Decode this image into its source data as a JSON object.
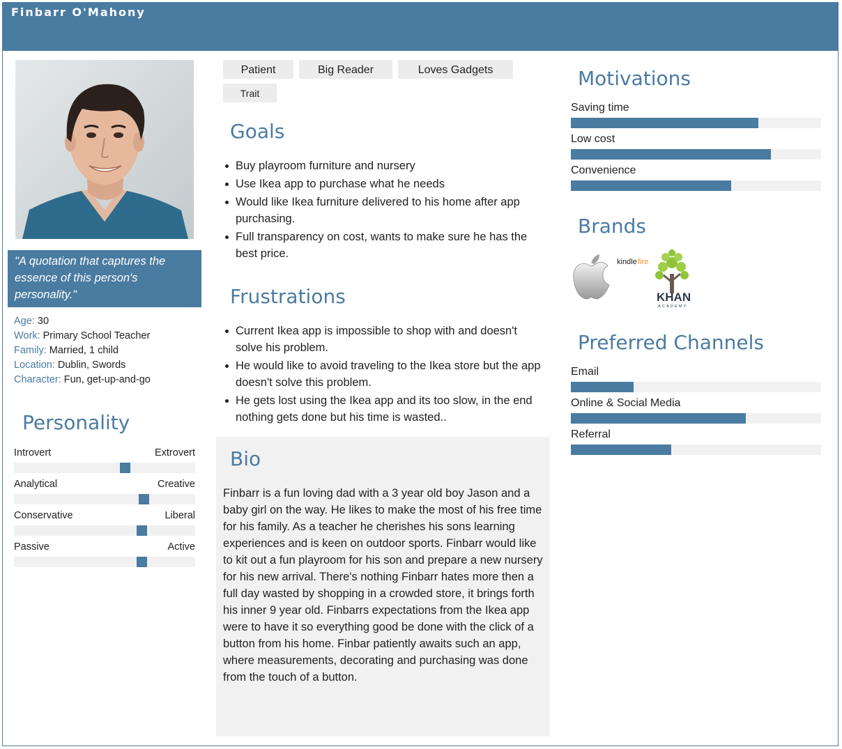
{
  "header": {
    "name": "Finbarr O'Mahony"
  },
  "profile": {
    "quote": "\"A quotation that captures the essence of this person's personality.\"",
    "facts": [
      {
        "key": "Age:",
        "value": "30"
      },
      {
        "key": "Work:",
        "value": "Primary School Teacher"
      },
      {
        "key": "Family:",
        "value": "Married, 1 child"
      },
      {
        "key": "Location:",
        "value": "Dublin, Swords"
      },
      {
        "key": "Character:",
        "value": "Fun, get-up-and-go"
      }
    ]
  },
  "personality": {
    "title": "Personality",
    "scales": [
      {
        "left": "Introvert",
        "right": "Extrovert",
        "level": 0.62
      },
      {
        "left": "Analytical",
        "right": "Creative",
        "level": 0.73
      },
      {
        "left": "Conservative",
        "right": "Liberal",
        "level": 0.72
      },
      {
        "left": "Passive",
        "right": "Active",
        "level": 0.72
      }
    ]
  },
  "traits": [
    "Patient",
    "Big Reader",
    "Loves Gadgets",
    "Trait"
  ],
  "goals": {
    "title": "Goals",
    "items": [
      "Buy playroom furniture and nursery",
      "Use Ikea app to purchase what he needs",
      "Would like Ikea furniture delivered to his home after app purchasing.",
      "Full transparency on cost, wants to make sure he has the best price."
    ]
  },
  "frustrations": {
    "title": "Frustrations",
    "items": [
      "Current Ikea app is impossible to shop with and doesn't solve his problem.",
      "He would like to avoid traveling to the Ikea store but the app doesn't solve this problem.",
      "He gets lost using the Ikea app and its too slow, in the end nothing gets done but his time is wasted.."
    ]
  },
  "bio": {
    "title": "Bio",
    "text": "Finbarr is a fun loving dad with a 3 year old boy Jason and a baby girl on the way. He likes to make the most of his free time for his family. As a teacher he cherishes his sons learning experiences and is keen on outdoor sports. Finbarr would like to kit out a fun playroom for his son and prepare a new nursery for his new arrival. There's nothing Finbarr hates more then a full day wasted by shopping in a crowded store, it brings forth his inner 9 year old. Finbarrs expectations from the Ikea app were to have it so everything good be done with the click of a button from his home. Finbar patiently awaits such an app, where measurements, decorating and purchasing was done from the touch of a button."
  },
  "motivations": {
    "title": "Motivations",
    "items": [
      {
        "label": "Saving time",
        "level": 0.75
      },
      {
        "label": "Low cost",
        "level": 0.8
      },
      {
        "label": "Convenience",
        "level": 0.64
      }
    ]
  },
  "brands": {
    "title": "Brands",
    "logos": [
      "apple-logo",
      "kindle-fire-logo",
      "khan-academy-logo"
    ],
    "kindle_text": "kindle",
    "kindle_fire_text": "fire",
    "khan_text": "KHAN",
    "khan_sub_text": "ACADEMY"
  },
  "channels": {
    "title": "Preferred Channels",
    "items": [
      {
        "label": "Email",
        "level": 0.25
      },
      {
        "label": "Online & Social Media",
        "level": 0.7
      },
      {
        "label": "Referral",
        "level": 0.4
      }
    ]
  },
  "colors": {
    "accent": "#4a7ba1",
    "panel": "#f1f1f1",
    "tag": "#ececec"
  }
}
